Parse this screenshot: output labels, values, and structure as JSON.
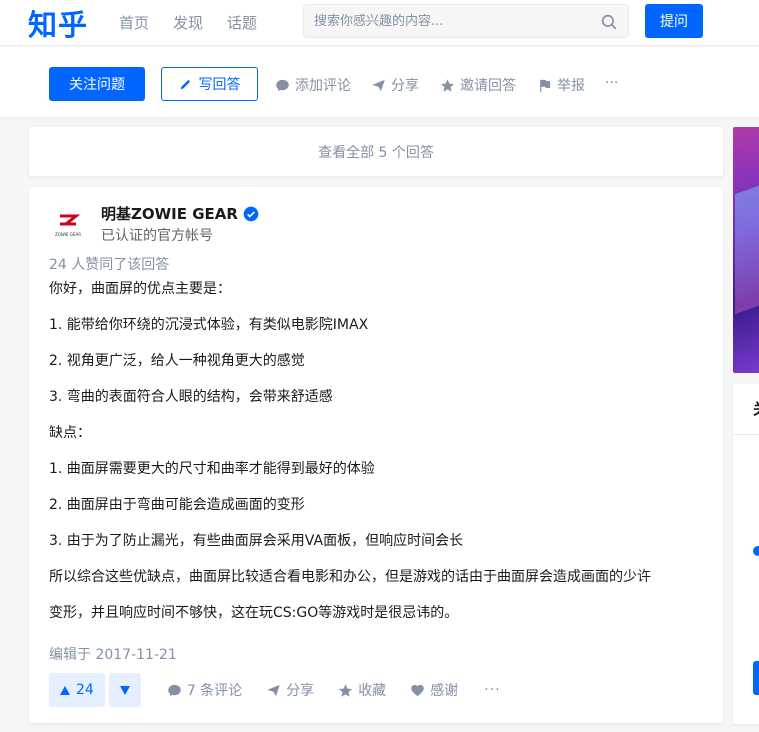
{
  "app": {
    "logo": "知乎",
    "nav": [
      "首页",
      "发现",
      "话题"
    ],
    "search_placeholder": "搜索你感兴趣的内容...",
    "ask_label": "提问"
  },
  "question_bar": {
    "follow_label": "关注问题",
    "write_label": "写回答",
    "actions": [
      "添加评论",
      "分享",
      "邀请回答",
      "举报"
    ],
    "more": "···"
  },
  "view_all_label": "查看全部 5 个回答",
  "answer": {
    "avatar_text": "ZOWIE GEAR",
    "author_name": "明基ZOWIE GEAR",
    "author_desc": "已认证的官方帐号",
    "votes_line": "24 人赞同了该回答",
    "paragraphs": [
      "你好，曲面屏的优点主要是：",
      "1. 能带给你环绕的沉浸式体验，有类似电影院IMAX",
      "2. 视角更广泛，给人一种视角更大的感觉",
      "3. 弯曲的表面符合人眼的结构，会带来舒适感",
      "缺点：",
      "1. 曲面屏需要更大的尺寸和曲率才能得到最好的体验",
      "2. 曲面屏由于弯曲可能会造成画面的变形",
      "3. 由于为了防止漏光，有些曲面屏会采用VA面板，但响应时间会长",
      "所以综合这些优缺点，曲面屏比较适合看电影和办公，但是游戏的话由于曲面屏会造成画面的少许",
      "变形，并且响应时间不够快，这在玩CS:GO等游戏时是很忌讳的。"
    ],
    "edited": "编辑于 2017-11-21",
    "vote_count": "24",
    "comments_label": "7 条评论",
    "share_label": "分享",
    "collect_label": "收藏",
    "thanks_label": "感谢",
    "more": "···"
  },
  "sidebar": {
    "card_title_partial": "关"
  },
  "colors": {
    "brand": "#0066ff",
    "muted": "#8590a6",
    "background": "#f6f6f6"
  },
  "icons": [
    "search-icon",
    "pencil-icon",
    "comment-icon",
    "share-icon",
    "star-icon",
    "flag-icon",
    "verified-icon",
    "upvote-icon",
    "downvote-icon",
    "heart-icon"
  ]
}
